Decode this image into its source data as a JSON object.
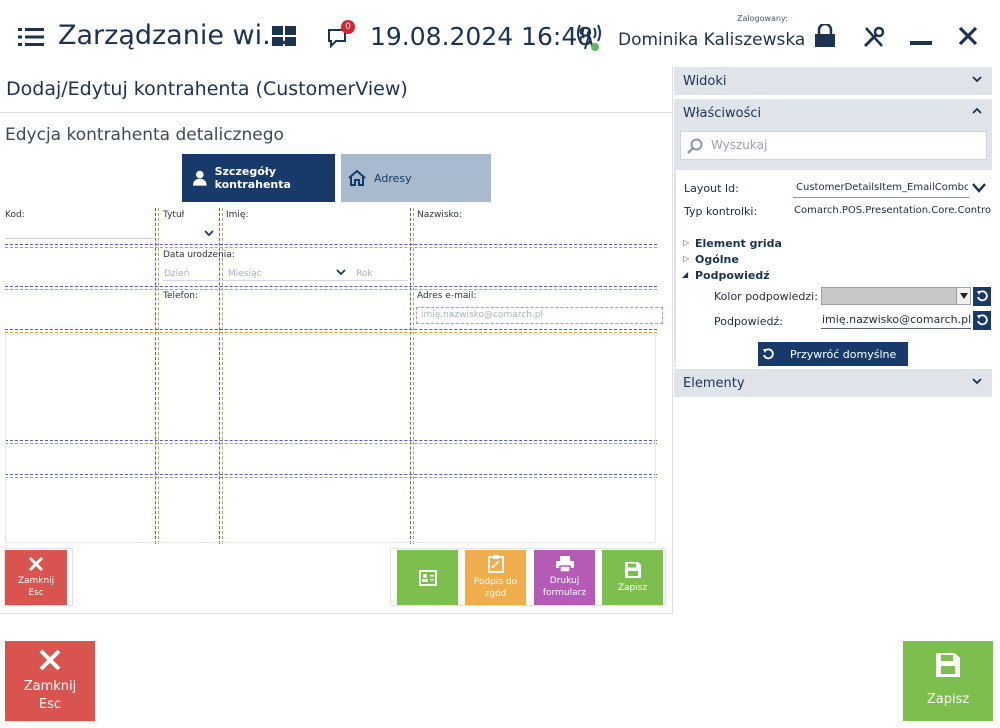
{
  "topbar": {
    "title": "Zarządzanie wi...",
    "notification_count": "0",
    "datetime": "19.08.2024 16:48",
    "logged_in_label": "Zalogowany:",
    "user_name": "Dominika Kaliszewska"
  },
  "editor": {
    "title": "Dodaj/Edytuj kontrahenta (CustomerView)",
    "subtitle": "Edycja kontrahenta detalicznego",
    "tabs": [
      {
        "label": "Szczegóły kontrahenta"
      },
      {
        "label": "Adresy"
      }
    ],
    "fields": {
      "kod": "Kod:",
      "tytul": "Tytuł",
      "imie": "Imię:",
      "nazwisko": "Nazwisko:",
      "data_urodzenia": "Data urodzenia:",
      "dzien": "Dzień",
      "miesiac": "Miesiąc",
      "rok": "Rok",
      "telefon": "Telefon:",
      "adres_email": "Adres e-mail:",
      "email_placeholder": "imię.nazwisko@comarch.pl"
    },
    "buttons": {
      "close_line1": "Zamknij",
      "close_line2": "Esc",
      "sign_line1": "Podpis do",
      "sign_line2": "zgód",
      "print_line1": "Drukuj",
      "print_line2": "formularz",
      "save": "Zapisz"
    }
  },
  "panel": {
    "sections": {
      "widoki": "Widoki",
      "wlasciwosci": "Właściwości",
      "elementy": "Elementy"
    },
    "search_placeholder": "Wyszukaj",
    "props": {
      "layout_id_label": "Layout Id:",
      "layout_id_value": "CustomerDetailsItem_EmailCombo",
      "control_type_label": "Typ kontrolki:",
      "control_type_value": "Comarch.POS.Presentation.Core.Controls"
    },
    "tree": {
      "grid_element": "Element grida",
      "general": "Ogólne",
      "hint": "Podpowiedź"
    },
    "hint_color_label": "Kolor podpowiedzi:",
    "hint_label": "Podpowiedź:",
    "hint_value": "imię.nazwisko@comarch.pl",
    "restore_defaults": "Przywróć domyślne"
  },
  "footer": {
    "close_line1": "Zamknij",
    "close_line2": "Esc",
    "save": "Zapisz"
  },
  "colors": {
    "navy": "#173a6b",
    "red": "#d9534f",
    "green": "#7cbf4e",
    "orange": "#f0ad4e",
    "purple": "#b55bb5"
  }
}
